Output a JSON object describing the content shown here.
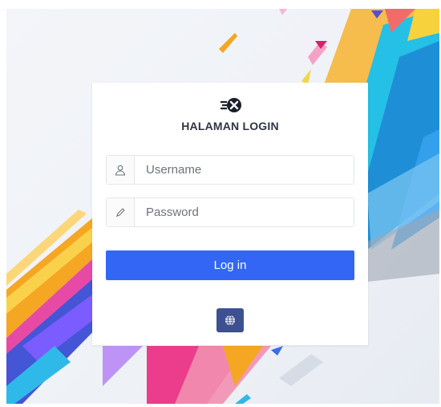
{
  "login": {
    "title": "HALAMAN LOGIN",
    "username_placeholder": "Username",
    "password_placeholder": "Password",
    "login_label": "Log in"
  },
  "icons": {
    "logo": "logo-icon",
    "username": "user-icon",
    "password": "pencil-icon",
    "language": "globe-icon"
  },
  "colors": {
    "primary": "#3366f5",
    "language_button": "#3d5191",
    "title_text": "#2f3542"
  }
}
